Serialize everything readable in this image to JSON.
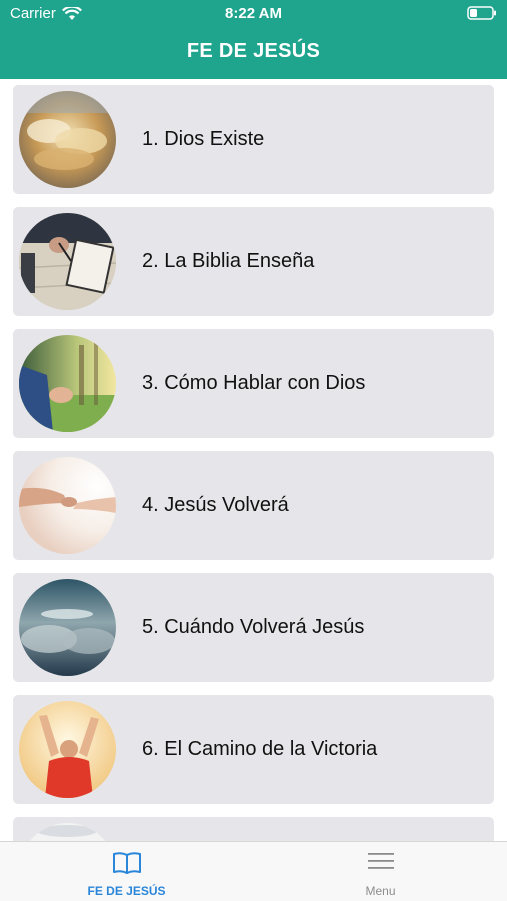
{
  "status_bar": {
    "carrier": "Carrier",
    "time": "8:22 AM",
    "wifi_icon": "wifi-icon",
    "battery_icon": "battery-icon"
  },
  "header": {
    "title": "FE DE JESÚS",
    "background_color": "#1fa48d"
  },
  "lessons": [
    {
      "label": "1. Dios Existe",
      "image": "clouds-sky"
    },
    {
      "label": "2. La Biblia Enseña",
      "image": "person-reading-bible"
    },
    {
      "label": "3. Cómo Hablar con Dios",
      "image": "praying-hands-outdoors"
    },
    {
      "label": "4. Jesús Volverá",
      "image": "reaching-hands-light"
    },
    {
      "label": "5. Cuándo Volverá Jesús",
      "image": "dramatic-clouds"
    },
    {
      "label": "6. El Camino de la Victoria",
      "image": "man-raising-arms"
    },
    {
      "label": "",
      "image": "partial-next-item"
    }
  ],
  "tabbar": {
    "tabs": [
      {
        "label": "FE DE JESÚS",
        "icon": "book-icon",
        "active": true,
        "color": "#2a86d9"
      },
      {
        "label": "Menu",
        "icon": "hamburger-menu-icon",
        "active": false,
        "color": "#8c8c8c"
      }
    ]
  }
}
